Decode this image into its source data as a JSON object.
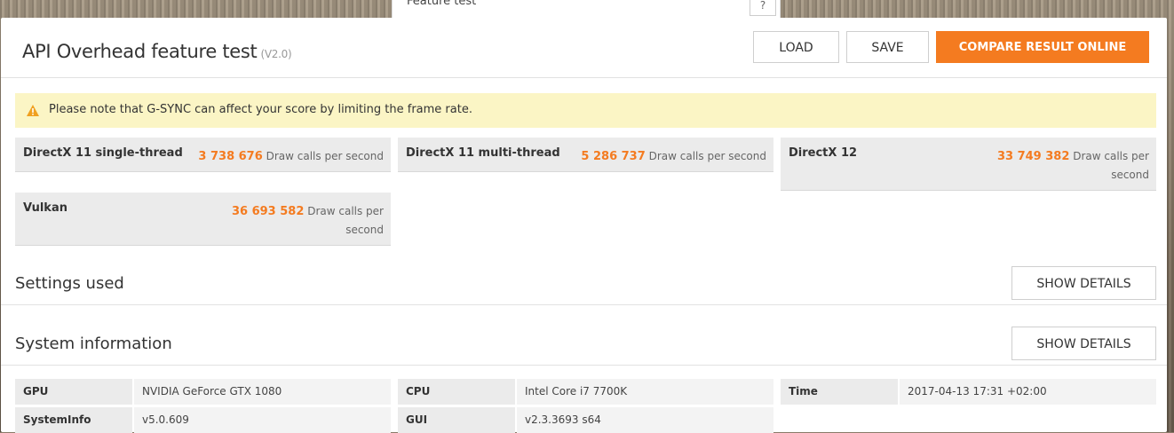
{
  "top_strip": {
    "label": "Feature test",
    "help": "?"
  },
  "header": {
    "title": "API Overhead feature test",
    "version": "(V2.0)",
    "load_label": "LOAD",
    "save_label": "SAVE",
    "compare_label": "COMPARE RESULT ONLINE"
  },
  "warning": {
    "text": "Please note that G-SYNC can affect your score by limiting the frame rate.",
    "color": "#fbf5c5",
    "icon": "warning-triangle-icon"
  },
  "scores": [
    {
      "name": "DirectX 11 single-thread",
      "value": "3 738 676",
      "unit": "Draw calls per second"
    },
    {
      "name": "DirectX 11 multi-thread",
      "value": "5 286 737",
      "unit": "Draw calls per second"
    },
    {
      "name": "DirectX 12",
      "value": "33 749 382",
      "unit": "Draw calls per second"
    },
    {
      "name": "Vulkan",
      "value": "36 693 582",
      "unit": "Draw calls per second"
    }
  ],
  "settings": {
    "title": "Settings used",
    "details_label": "SHOW DETAILS"
  },
  "system_info": {
    "title": "System information",
    "details_label": "SHOW DETAILS",
    "rows": [
      {
        "key": "GPU",
        "value": "NVIDIA GeForce GTX 1080"
      },
      {
        "key": "CPU",
        "value": "Intel Core i7 7700K"
      },
      {
        "key": "Time",
        "value": "2017-04-13 17:31 +02:00"
      },
      {
        "key": "SystemInfo",
        "value": "v5.0.609"
      },
      {
        "key": "GUI",
        "value": "v2.3.3693 s64"
      }
    ]
  },
  "colors": {
    "accent": "#f47b20",
    "warning_bg": "#fbf5c5",
    "cell_bg": "#ebebeb"
  }
}
